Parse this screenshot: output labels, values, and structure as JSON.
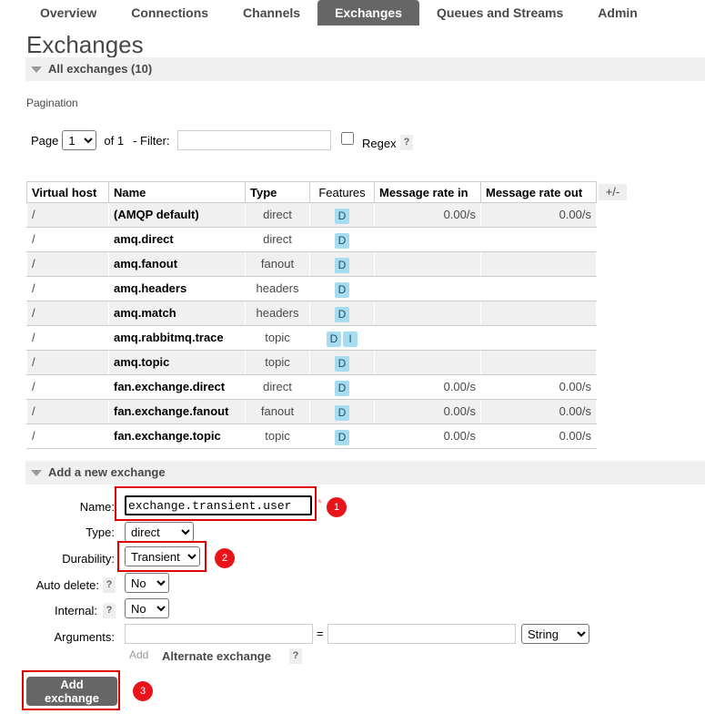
{
  "nav": {
    "tabs": [
      {
        "label": "Overview"
      },
      {
        "label": "Connections"
      },
      {
        "label": "Channels"
      },
      {
        "label": "Exchanges"
      },
      {
        "label": "Queues and Streams"
      },
      {
        "label": "Admin"
      }
    ],
    "active": "Exchanges"
  },
  "page": {
    "title": "Exchanges",
    "all_section": "All exchanges (10)"
  },
  "pagination": {
    "heading": "Pagination",
    "page_label": "Page",
    "page_value": "1",
    "of_label": "of 1",
    "filter_label": "- Filter:",
    "filter_value": "",
    "regex_label": "Regex",
    "regex_checked": false,
    "help": "?"
  },
  "table": {
    "columns": [
      "Virtual host",
      "Name",
      "Type",
      "Features",
      "Message rate in",
      "Message rate out"
    ],
    "toggle": "+/-",
    "rows": [
      {
        "vhost": "/",
        "name": "(AMQP default)",
        "type": "direct",
        "features": [
          "D"
        ],
        "rate_in": "0.00/s",
        "rate_out": "0.00/s"
      },
      {
        "vhost": "/",
        "name": "amq.direct",
        "type": "direct",
        "features": [
          "D"
        ],
        "rate_in": "",
        "rate_out": ""
      },
      {
        "vhost": "/",
        "name": "amq.fanout",
        "type": "fanout",
        "features": [
          "D"
        ],
        "rate_in": "",
        "rate_out": ""
      },
      {
        "vhost": "/",
        "name": "amq.headers",
        "type": "headers",
        "features": [
          "D"
        ],
        "rate_in": "",
        "rate_out": ""
      },
      {
        "vhost": "/",
        "name": "amq.match",
        "type": "headers",
        "features": [
          "D"
        ],
        "rate_in": "",
        "rate_out": ""
      },
      {
        "vhost": "/",
        "name": "amq.rabbitmq.trace",
        "type": "topic",
        "features": [
          "D",
          "I"
        ],
        "rate_in": "",
        "rate_out": ""
      },
      {
        "vhost": "/",
        "name": "amq.topic",
        "type": "topic",
        "features": [
          "D"
        ],
        "rate_in": "",
        "rate_out": ""
      },
      {
        "vhost": "/",
        "name": "fan.exchange.direct",
        "type": "direct",
        "features": [
          "D"
        ],
        "rate_in": "0.00/s",
        "rate_out": "0.00/s"
      },
      {
        "vhost": "/",
        "name": "fan.exchange.fanout",
        "type": "fanout",
        "features": [
          "D"
        ],
        "rate_in": "0.00/s",
        "rate_out": "0.00/s"
      },
      {
        "vhost": "/",
        "name": "fan.exchange.topic",
        "type": "topic",
        "features": [
          "D"
        ],
        "rate_in": "0.00/s",
        "rate_out": "0.00/s"
      }
    ]
  },
  "add_form": {
    "section": "Add a new exchange",
    "name_label": "Name:",
    "name_value": "exchange.transient.user",
    "required_mark": "*",
    "type_label": "Type:",
    "type_value": "direct",
    "durability_label": "Durability:",
    "durability_value": "Transient",
    "auto_delete_label": "Auto delete:",
    "auto_delete_value": "No",
    "internal_label": "Internal:",
    "internal_value": "No",
    "arguments_label": "Arguments:",
    "arg_equals": "=",
    "arg_type_value": "String",
    "add_label": "Add",
    "alternate_exchange": "Alternate exchange",
    "help": "?",
    "submit_label": "Add exchange"
  },
  "markers": [
    "1",
    "2",
    "3"
  ],
  "colors": {
    "active_tab": "#666666",
    "section_bg": "#f0f0f0",
    "badge": "#a6dcef",
    "annotation_red": "#e00000"
  }
}
